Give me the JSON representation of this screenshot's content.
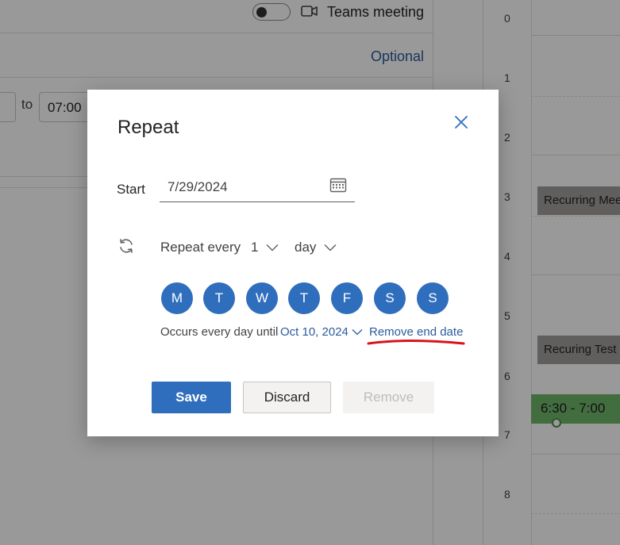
{
  "background": {
    "teams_label": "Teams meeting",
    "optional_label": "Optional",
    "to_label": "to",
    "end_time": "07:00"
  },
  "calendar": {
    "hours": [
      "0",
      "1",
      "2",
      "3",
      "4",
      "5",
      "6",
      "7",
      "8"
    ],
    "events": {
      "recurring_meeting": "Recurring Meeting",
      "recurring_test": "Recuring Test Item",
      "green_event": "6:30 - 7:00"
    }
  },
  "dialog": {
    "title": "Repeat",
    "close_icon": "close-icon",
    "start_label": "Start",
    "start_date": "7/29/2024",
    "repeat_label": "Repeat every",
    "repeat_count": "1",
    "repeat_unit": "day",
    "days": [
      "M",
      "T",
      "W",
      "T",
      "F",
      "S",
      "S"
    ],
    "occurs_text": "Occurs every day until",
    "end_date": "Oct 10, 2024",
    "remove_end_date": "Remove end date",
    "save_label": "Save",
    "discard_label": "Discard",
    "remove_label": "Remove"
  },
  "colors": {
    "accent": "#2f6ebd",
    "link": "#2b5b9c",
    "annotation_red": "#d8141b",
    "event_green": "#6fb66a",
    "event_gray": "#a19f9d"
  }
}
